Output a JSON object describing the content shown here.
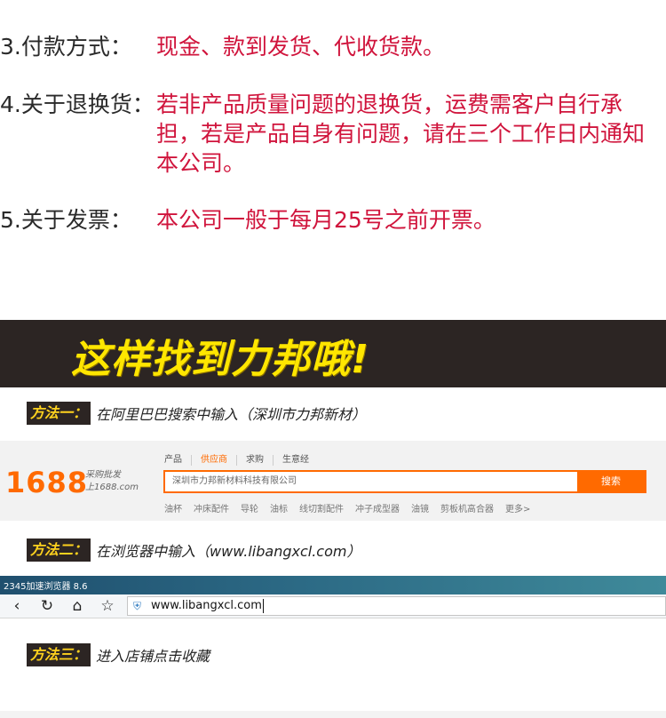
{
  "terms": [
    {
      "label": "3.付款方式：",
      "value": "现金、款到发货、代收货款。"
    },
    {
      "label": "4.关于退换货：",
      "value": "若非产品质量问题的退换货，运费需客户自行承担，若是产品自身有问题，请在三个工作日内通知本公司。"
    },
    {
      "label": "5.关于发票：",
      "value": "本公司一般于每月25号之前开票。"
    }
  ],
  "banner": {
    "title": "这样找到力邦哦!"
  },
  "methods": [
    {
      "badge": "方法一：",
      "text": "在阿里巴巴搜索中输入（深圳市力邦新材）"
    },
    {
      "badge": "方法二：",
      "text": "在浏览器中输入（www.libangxcl.com）"
    },
    {
      "badge": "方法三：",
      "text": "进入店铺点击收藏"
    }
  ],
  "site1688": {
    "logo": "1688",
    "logo_sub1": "采购批发",
    "logo_sub2": "上1688.com",
    "tabs": [
      "产品",
      "供应商",
      "求购",
      "生意经"
    ],
    "active_tab": "供应商",
    "search_value": "深圳市力邦新材料科技有限公司",
    "search_button": "搜索",
    "hot_words": [
      "油杯",
      "冲床配件",
      "导轮",
      "油标",
      "线切割配件",
      "冲子成型器",
      "油镜",
      "剪板机高合器",
      "更多>"
    ]
  },
  "browser": {
    "title": "2345加速浏览器 8.6",
    "url": "www.libangxcl.com",
    "icons": [
      "back-icon",
      "refresh-icon",
      "home-icon",
      "star-icon",
      "shield-icon"
    ]
  },
  "colors": {
    "accent_red": "#d0143c",
    "banner_bg": "#2c2523",
    "banner_text": "#ffe600",
    "brand_orange": "#ff6a00"
  }
}
